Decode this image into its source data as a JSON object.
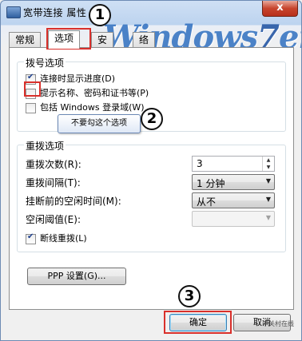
{
  "window": {
    "title": "宽带连接 属性",
    "close_glyph": "x"
  },
  "watermark": {
    "prefix": "Windows",
    "seven": "7",
    "suffix": "en"
  },
  "tabs": [
    {
      "label": "常规"
    },
    {
      "label": "选项"
    },
    {
      "label": "安"
    },
    {
      "label": "络"
    }
  ],
  "dial_options": {
    "legend": "拨号选项",
    "items": [
      {
        "label": "连接时显示进度(D)",
        "checked": true
      },
      {
        "label": "提示名称、密码和证书等(P)",
        "checked": false
      },
      {
        "label": "包括 Windows 登录域(W)",
        "checked": false
      }
    ]
  },
  "tooltip": {
    "text": "不要勾这个选项"
  },
  "redial_options": {
    "legend": "重拨选项",
    "redial_count_label": "重拨次数(R):",
    "redial_count_value": "3",
    "redial_interval_label": "重拨间隔(T):",
    "redial_interval_value": "1 分钟",
    "idle_hangup_label": "挂断前的空闲时间(M):",
    "idle_hangup_value": "从不",
    "idle_threshold_label": "空闲阈值(E):",
    "idle_threshold_value": "",
    "reconnect_label": "断线重拨(L)",
    "reconnect_checked": true
  },
  "ppp_button": "PPP 设置(G)...",
  "footer": {
    "ok_label": "确定",
    "cancel_label": "取消",
    "site_mark": "中关村在线"
  },
  "annotations": [
    "1",
    "2",
    "3"
  ]
}
